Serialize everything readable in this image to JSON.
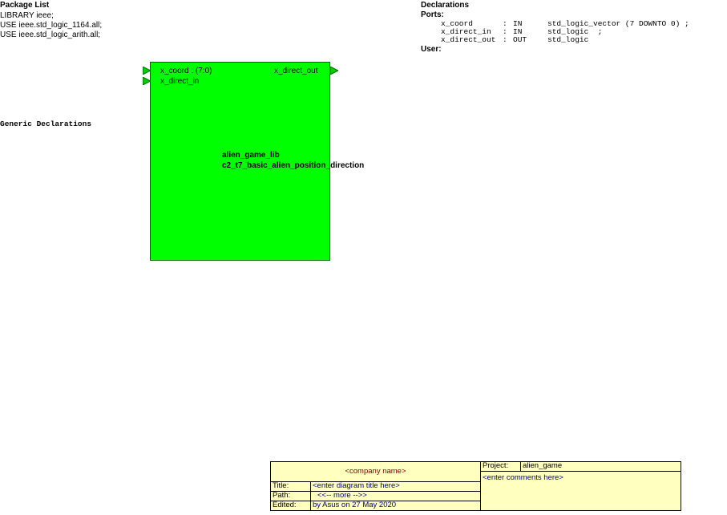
{
  "package_list": {
    "title": "Package List",
    "lines": [
      "LIBRARY ieee;",
      "USE ieee.std_logic_1164.all;",
      "USE ieee.std_logic_arith.all;"
    ]
  },
  "declarations": {
    "title": "Declarations",
    "ports_title": "Ports:",
    "ports": [
      {
        "name": "x_coord",
        "colon": ":",
        "mode": "IN",
        "type": "std_logic_vector (7 DOWNTO 0) ;"
      },
      {
        "name": "x_direct_in",
        "colon": ":",
        "mode": "IN",
        "type": "std_logic  ;"
      },
      {
        "name": "x_direct_out",
        "colon": ":",
        "mode": "OUT",
        "type": "std_logic"
      }
    ],
    "user_title": "User:"
  },
  "generic": {
    "title": "Generic Declarations"
  },
  "block": {
    "fill": "#00ff00",
    "port_color": "#00cc00",
    "in_ports": [
      "x_coord : (7:0)",
      "x_direct_in"
    ],
    "out_ports": [
      "x_direct_out"
    ],
    "library": "alien_game_lib",
    "entity": "c2_t7_basic_alien_position_direction"
  },
  "title_block": {
    "fill": "#ffffc0",
    "company": "<company name>",
    "title_label": "Title:",
    "title_value": "<enter diagram title here>",
    "path_label": "Path:",
    "path_value": "<<-- more -->>",
    "edited_label": "Edited:",
    "edited_value": "by Asus on 27 May 2020",
    "project_label": "Project:",
    "project_value": "alien_game",
    "comments": "<enter comments here>"
  }
}
